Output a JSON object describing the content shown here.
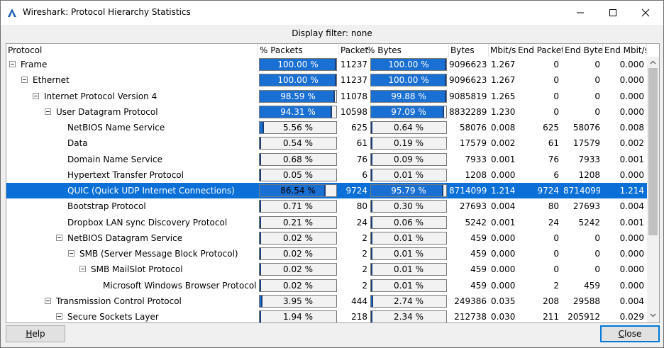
{
  "window": {
    "title": "Wireshark: Protocol Hierarchy Statistics",
    "icon": "wireshark-fin-icon",
    "controls": [
      "minimize-icon",
      "maximize-icon",
      "close-icon"
    ]
  },
  "display_filter": "Display filter: none",
  "columns": [
    "Protocol",
    "% Packets",
    "Packets",
    "% Bytes",
    "Bytes",
    "Mbit/s",
    "End Packets",
    "End Bytes",
    "End  Mbit/s"
  ],
  "rows": [
    {
      "protocol": "Frame",
      "level": 0,
      "expandable": true,
      "pct_packets": "100.00 %",
      "pct_packets_value": 100.0,
      "packets": "11237",
      "pct_bytes": "100.00 %",
      "pct_bytes_value": 100.0,
      "bytes": "9096623",
      "mbits": "1.267",
      "end_packets": "0",
      "end_bytes": "0",
      "end_mbits": "0.000"
    },
    {
      "protocol": "Ethernet",
      "level": 1,
      "expandable": true,
      "pct_packets": "100.00 %",
      "pct_packets_value": 100.0,
      "packets": "11237",
      "pct_bytes": "100.00 %",
      "pct_bytes_value": 100.0,
      "bytes": "9096623",
      "mbits": "1.267",
      "end_packets": "0",
      "end_bytes": "0",
      "end_mbits": "0.000"
    },
    {
      "protocol": "Internet Protocol Version 4",
      "level": 2,
      "expandable": true,
      "pct_packets": "98.59 %",
      "pct_packets_value": 98.59,
      "packets": "11078",
      "pct_bytes": "99.88 %",
      "pct_bytes_value": 99.88,
      "bytes": "9085819",
      "mbits": "1.265",
      "end_packets": "0",
      "end_bytes": "0",
      "end_mbits": "0.000"
    },
    {
      "protocol": "User Datagram Protocol",
      "level": 3,
      "expandable": true,
      "pct_packets": "94.31 %",
      "pct_packets_value": 94.31,
      "packets": "10598",
      "pct_bytes": "97.09 %",
      "pct_bytes_value": 97.09,
      "bytes": "8832289",
      "mbits": "1.230",
      "end_packets": "0",
      "end_bytes": "0",
      "end_mbits": "0.000"
    },
    {
      "protocol": "NetBIOS Name Service",
      "level": 4,
      "expandable": false,
      "pct_packets": "5.56 %",
      "pct_packets_value": 5.56,
      "packets": "625",
      "pct_bytes": "0.64 %",
      "pct_bytes_value": 0.64,
      "bytes": "58076",
      "mbits": "0.008",
      "end_packets": "625",
      "end_bytes": "58076",
      "end_mbits": "0.008"
    },
    {
      "protocol": "Data",
      "level": 4,
      "expandable": false,
      "pct_packets": "0.54 %",
      "pct_packets_value": 0.54,
      "packets": "61",
      "pct_bytes": "0.19 %",
      "pct_bytes_value": 0.19,
      "bytes": "17579",
      "mbits": "0.002",
      "end_packets": "61",
      "end_bytes": "17579",
      "end_mbits": "0.002"
    },
    {
      "protocol": "Domain Name Service",
      "level": 4,
      "expandable": false,
      "pct_packets": "0.68 %",
      "pct_packets_value": 0.68,
      "packets": "76",
      "pct_bytes": "0.09 %",
      "pct_bytes_value": 0.09,
      "bytes": "7933",
      "mbits": "0.001",
      "end_packets": "76",
      "end_bytes": "7933",
      "end_mbits": "0.001"
    },
    {
      "protocol": "Hypertext Transfer Protocol",
      "level": 4,
      "expandable": false,
      "pct_packets": "0.05 %",
      "pct_packets_value": 0.05,
      "packets": "6",
      "pct_bytes": "0.01 %",
      "pct_bytes_value": 0.01,
      "bytes": "1208",
      "mbits": "0.000",
      "end_packets": "6",
      "end_bytes": "1208",
      "end_mbits": "0.000"
    },
    {
      "protocol": "QUIC (Quick UDP Internet Connections)",
      "level": 4,
      "expandable": false,
      "selected": true,
      "pct_packets": "86.54 %",
      "pct_packets_value": 86.54,
      "packets": "9724",
      "pct_bytes": "95.79 %",
      "pct_bytes_value": 95.79,
      "bytes": "8714099",
      "mbits": "1.214",
      "end_packets": "9724",
      "end_bytes": "8714099",
      "end_mbits": "1.214"
    },
    {
      "protocol": "Bootstrap Protocol",
      "level": 4,
      "expandable": false,
      "pct_packets": "0.71 %",
      "pct_packets_value": 0.71,
      "packets": "80",
      "pct_bytes": "0.30 %",
      "pct_bytes_value": 0.3,
      "bytes": "27693",
      "mbits": "0.004",
      "end_packets": "80",
      "end_bytes": "27693",
      "end_mbits": "0.004"
    },
    {
      "protocol": "Dropbox LAN sync Discovery Protocol",
      "level": 4,
      "expandable": false,
      "pct_packets": "0.21 %",
      "pct_packets_value": 0.21,
      "packets": "24",
      "pct_bytes": "0.06 %",
      "pct_bytes_value": 0.06,
      "bytes": "5242",
      "mbits": "0.001",
      "end_packets": "24",
      "end_bytes": "5242",
      "end_mbits": "0.001"
    },
    {
      "protocol": "NetBIOS Datagram Service",
      "level": 4,
      "expandable": true,
      "pct_packets": "0.02 %",
      "pct_packets_value": 0.02,
      "packets": "2",
      "pct_bytes": "0.01 %",
      "pct_bytes_value": 0.01,
      "bytes": "459",
      "mbits": "0.000",
      "end_packets": "0",
      "end_bytes": "0",
      "end_mbits": "0.000"
    },
    {
      "protocol": "SMB (Server Message Block Protocol)",
      "level": 5,
      "expandable": true,
      "pct_packets": "0.02 %",
      "pct_packets_value": 0.02,
      "packets": "2",
      "pct_bytes": "0.01 %",
      "pct_bytes_value": 0.01,
      "bytes": "459",
      "mbits": "0.000",
      "end_packets": "0",
      "end_bytes": "0",
      "end_mbits": "0.000"
    },
    {
      "protocol": "SMB MailSlot Protocol",
      "level": 6,
      "expandable": true,
      "pct_packets": "0.02 %",
      "pct_packets_value": 0.02,
      "packets": "2",
      "pct_bytes": "0.01 %",
      "pct_bytes_value": 0.01,
      "bytes": "459",
      "mbits": "0.000",
      "end_packets": "0",
      "end_bytes": "0",
      "end_mbits": "0.000"
    },
    {
      "protocol": "Microsoft Windows Browser Protocol",
      "level": 7,
      "expandable": false,
      "pct_packets": "0.02 %",
      "pct_packets_value": 0.02,
      "packets": "2",
      "pct_bytes": "0.01 %",
      "pct_bytes_value": 0.01,
      "bytes": "459",
      "mbits": "0.000",
      "end_packets": "2",
      "end_bytes": "459",
      "end_mbits": "0.000"
    },
    {
      "protocol": "Transmission Control Protocol",
      "level": 3,
      "expandable": true,
      "pct_packets": "3.95 %",
      "pct_packets_value": 3.95,
      "packets": "444",
      "pct_bytes": "2.74 %",
      "pct_bytes_value": 2.74,
      "bytes": "249386",
      "mbits": "0.035",
      "end_packets": "208",
      "end_bytes": "29588",
      "end_mbits": "0.004"
    },
    {
      "protocol": "Secure Sockets Layer",
      "level": 4,
      "expandable": true,
      "pct_packets": "1.94 %",
      "pct_packets_value": 1.94,
      "packets": "218",
      "pct_bytes": "2.34 %",
      "pct_bytes_value": 2.34,
      "bytes": "212738",
      "mbits": "0.030",
      "end_packets": "211",
      "end_bytes": "205912",
      "end_mbits": "0.029"
    }
  ],
  "buttons": {
    "help_rest": "elp",
    "help_accel": "H",
    "close_accel": "C",
    "close_rest": "lose"
  },
  "colors": {
    "selection": "#0a6fd6",
    "bar_fill": "#1a6fd3",
    "focus_border": "#0078d7"
  },
  "scrollbar": {
    "up_icon": "chevron-up-icon",
    "down_icon": "chevron-down-icon"
  }
}
